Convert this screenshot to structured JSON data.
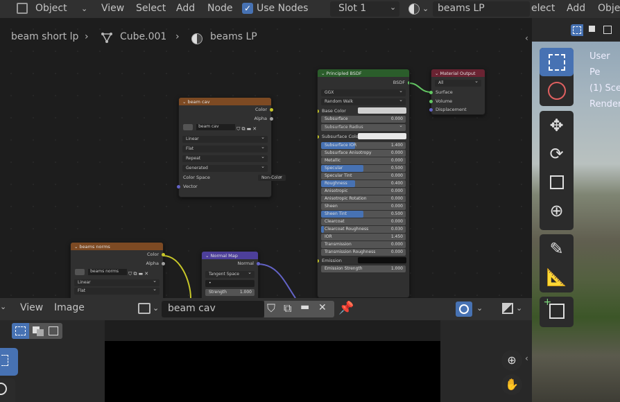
{
  "header": {
    "mode": "Object",
    "menus": [
      "View",
      "Select",
      "Add",
      "Node"
    ],
    "use_nodes_label": "Use Nodes",
    "slot": "Slot 1",
    "material": "beams LP",
    "right_menus": [
      "elect",
      "Add",
      "Obje"
    ]
  },
  "breadcrumb": {
    "object": "beam short lp",
    "mesh": "Cube.001",
    "material": "beams LP"
  },
  "nodes": {
    "beam_cav": {
      "title": "beam cav",
      "out_color": "Color",
      "out_alpha": "Alpha",
      "image": "beam cav",
      "interpolation": "Linear",
      "projection": "Flat",
      "extension": "Repeat",
      "source": "Generated",
      "color_space_label": "Color Space",
      "color_space": "Non-Color",
      "in_vector": "Vector"
    },
    "beams_norms": {
      "title": "beams norms",
      "out_color": "Color",
      "out_alpha": "Alpha",
      "image": "beams norms",
      "interpolation": "Linear",
      "projection": "Flat"
    },
    "normal_map": {
      "title": "Normal Map",
      "out_normal": "Normal",
      "space": "Tangent Space",
      "uvmap": "•",
      "strength_label": "Strength",
      "strength": "1.000"
    },
    "bsdf": {
      "title": "Principled BSDF",
      "out": "BSDF",
      "distribution": "GGX",
      "subsurface_method": "Random Walk",
      "base_color_label": "Base Color",
      "base_color": "#cfcfcf",
      "subsurface_color_label": "Subsurface Colo",
      "subsurface_color": "#e8e8e8",
      "subsurface_radius_label": "Subsurface Radius",
      "emission_label": "Emission",
      "emission_color": "#0e0e0e",
      "fields": [
        {
          "label": "Subsurface",
          "value": "0.000",
          "fill": 0
        },
        {
          "label": "Subsurface IOR",
          "value": "1.400",
          "fill": 0.4
        },
        {
          "label": "Subsurface Anisotropy",
          "value": "0.000",
          "fill": 0
        },
        {
          "label": "Metallic",
          "value": "0.000",
          "fill": 0
        },
        {
          "label": "Specular",
          "value": "0.500",
          "fill": 0.5
        },
        {
          "label": "Specular Tint",
          "value": "0.000",
          "fill": 0
        },
        {
          "label": "Roughness",
          "value": "0.400",
          "fill": 0.4
        },
        {
          "label": "Anisotropic",
          "value": "0.000",
          "fill": 0
        },
        {
          "label": "Anisotropic Rotation",
          "value": "0.000",
          "fill": 0
        },
        {
          "label": "Sheen",
          "value": "0.000",
          "fill": 0
        },
        {
          "label": "Sheen Tint",
          "value": "0.500",
          "fill": 0.5
        },
        {
          "label": "Clearcoat",
          "value": "0.000",
          "fill": 0
        },
        {
          "label": "Clearcoat Roughness",
          "value": "0.030",
          "fill": 0.03
        },
        {
          "label": "IOR",
          "value": "1.450",
          "fill": 0
        },
        {
          "label": "Transmission",
          "value": "0.000",
          "fill": 0
        },
        {
          "label": "Transmission Roughness",
          "value": "0.000",
          "fill": 0
        }
      ],
      "emission_strength_label": "Emission Strength",
      "emission_strength": "1.000"
    },
    "output": {
      "title": "Material Output",
      "target": "All",
      "in_surface": "Surface",
      "in_volume": "Volume",
      "in_displacement": "Displacement"
    }
  },
  "image_editor": {
    "menus": [
      "View",
      "Image"
    ],
    "image_name": "beam cav"
  },
  "viewport": {
    "overlay_lines": [
      "User Pe",
      "(1) Sce",
      "Render"
    ]
  },
  "colors": {
    "accent": "#4772b3",
    "texture_header": "#7d4a23",
    "shader_header": "#2b5d2b",
    "output_header": "#6a2332",
    "vector_header": "#4d3f9a"
  }
}
